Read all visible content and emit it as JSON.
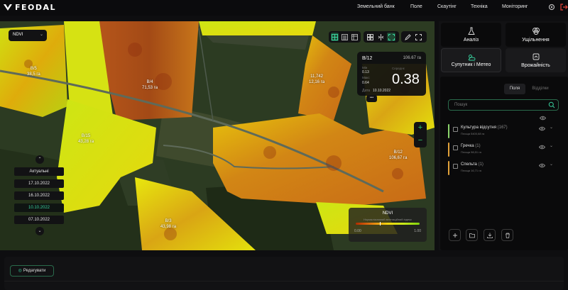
{
  "brand": {
    "name": "FEODAL",
    "accent": "#38d39f"
  },
  "nav": [
    "Земельний банк",
    "Поле",
    "Скаутінг",
    "Техніка",
    "Моніторинг"
  ],
  "top_icons": [
    "settings-icon",
    "logout-icon"
  ],
  "map": {
    "index_select": "NDVI",
    "fields": [
      {
        "name": "B/5",
        "area": "38,5 га"
      },
      {
        "name": "B/4",
        "area": "71,53 га"
      },
      {
        "name": "11,742",
        "area": "12,16 га"
      },
      {
        "name": "B/15",
        "area": "43,28 га"
      },
      {
        "name": "B/12",
        "area": "106,67 га"
      },
      {
        "name": "B/3",
        "area": "43,98 га"
      }
    ],
    "info_card": {
      "name": "В/12",
      "area": "106.67 га",
      "min_label": "Мін",
      "min_value": "0.13",
      "max_label": "Макс",
      "max_value": "0.64",
      "avg_label": "Середнє",
      "avg_value": "0.38",
      "date_label": "Дата",
      "date_value": "10.10.2022",
      "tail": "•••"
    },
    "zoom": {
      "in": "+",
      "out": "−"
    },
    "dates": {
      "up": "⌃",
      "down": "⌄",
      "items": [
        "Актуальні",
        "17.10.2022",
        "16.10.2022",
        "10.10.2022",
        "07.10.2022"
      ],
      "active_index": 3
    },
    "legend": {
      "title": "NDVI",
      "subtitle": "Нормалізований вегетаційний індекс",
      "min": "0.00",
      "max": "1.00",
      "value": 0.38
    }
  },
  "panel": {
    "tabs": [
      {
        "label": "Аналіз",
        "icon": "flask-icon"
      },
      {
        "label": "Ущільнення",
        "icon": "layers-icon"
      },
      {
        "label": "Супутник і Метео",
        "icon": "weather-icon"
      },
      {
        "label": "Врожайність",
        "icon": "yield-icon"
      }
    ],
    "segments": [
      "Поля",
      "Відділки"
    ],
    "search_placeholder": "Пошук",
    "crops": [
      {
        "name": "Культура відсутня",
        "count": "(167)",
        "area": "Площа 5400,68 га",
        "color": "#8bd46b"
      },
      {
        "name": "Гречка",
        "count": "(1)",
        "area": "Площа 98,51 га",
        "color": "#e2a23a"
      },
      {
        "name": "Спельта",
        "count": "(1)",
        "area": "Площа 16,71 га",
        "color": "#e2a23a"
      }
    ],
    "actions": [
      "add-icon",
      "folder-icon",
      "download-icon",
      "trash-icon"
    ]
  },
  "bottom": {
    "edit_label": "Редагувати"
  }
}
